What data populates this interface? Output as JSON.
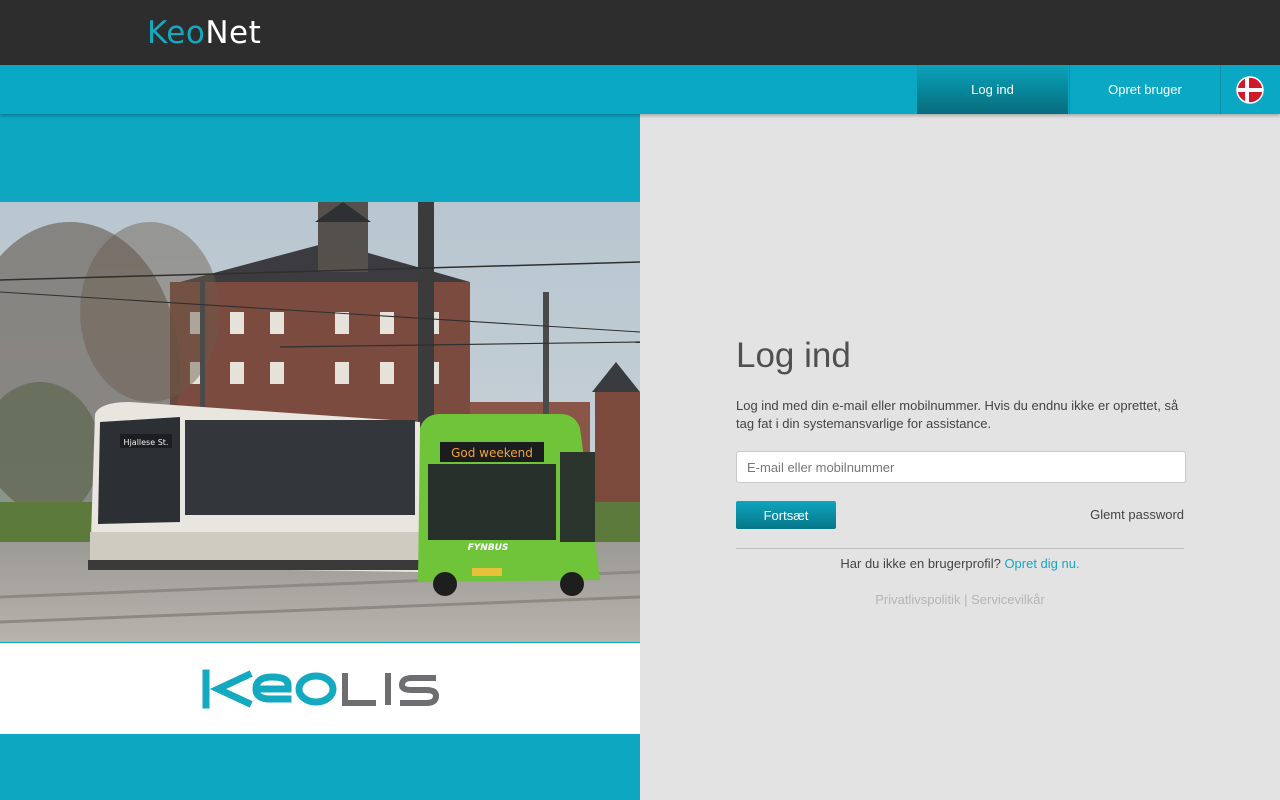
{
  "header": {
    "logo_part1": "Keo",
    "logo_part2": "Net"
  },
  "nav": {
    "login_label": "Log ind",
    "register_label": "Opret bruger",
    "language_flag": "denmark-flag-icon"
  },
  "banner": {
    "tram_sign": "Hjallese St.",
    "bus_sign": "God weekend",
    "bus_brand": "FYNBUS",
    "company_logo": "KEOLIS"
  },
  "login": {
    "title": "Log ind",
    "description": "Log ind med din e-mail eller mobilnummer. Hvis du endnu ikke er oprettet, så tag fat i din systemansvarlige for assistance.",
    "email_placeholder": "E-mail eller mobilnummer",
    "email_value": "",
    "continue_label": "Fortsæt",
    "forgot_label": "Glemt password",
    "signup_prompt": "Har du ikke en brugerprofil?",
    "signup_link": "Opret dig nu.",
    "privacy_label": "Privatlivspolitik",
    "separator": "|",
    "terms_label": "Servicevilkår"
  },
  "colors": {
    "accent": "#0aa8c4",
    "topbar": "#2d2d2d",
    "panel_bg": "#e3e3e3",
    "keolis_teal": "#13aac1",
    "keolis_gray": "#6e6e70",
    "bus_green": "#6fc43a"
  }
}
